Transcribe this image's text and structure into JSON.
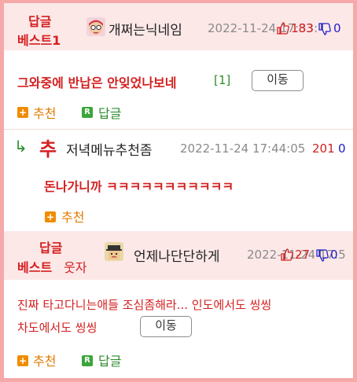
{
  "best_reply": {
    "badge_line1": "답글",
    "badge_line2": "베스트1",
    "author": "개쩌는닉네임",
    "datetime": "2022-11-24 17:33:",
    "votes_up": "183",
    "votes_down": "0",
    "content": "그와중에 반납은 안잊었나보네",
    "comment_count": "[1]",
    "move_label": "이동",
    "recommend_label": "추천",
    "reply_label": "답글"
  },
  "sub_reply": {
    "reply_arrow": "↳",
    "rec_glyph": "추",
    "author": "저녁메뉴추천좀",
    "datetime": "2022-11-24 17:44:05",
    "votes_up": "201",
    "votes_down": "0",
    "content": "돈나가니까 ㅋㅋㅋㅋㅋㅋㅋㅋㅋㅋㅋ",
    "recommend_label": "추천"
  },
  "best_humor": {
    "badge_line1": "답글",
    "badge_line2": "베스트",
    "category": "웃자",
    "author": "언제나단단하게",
    "datetime": "2022-11-24 17:5",
    "votes_up": "27",
    "votes_down": "0",
    "content_line1": "진짜 타고다니는애들 조심좀해라... 인도에서도 씽씽",
    "content_line2": "차도에서도 씽씽",
    "move_label": "이동",
    "recommend_label": "추천",
    "reply_label": "답글"
  },
  "icons": {
    "thumb_up": "thumb-up-icon",
    "thumb_down": "thumb-down-icon",
    "plus": "plus-icon",
    "reply_r": "reply-r-icon"
  },
  "colors": {
    "accent_red": "#d42020",
    "accent_blue": "#2020c8",
    "border_pink": "#f5a9a9",
    "band_pink": "#fde8e8",
    "green": "#2e8b2e",
    "orange": "#e07b00"
  }
}
